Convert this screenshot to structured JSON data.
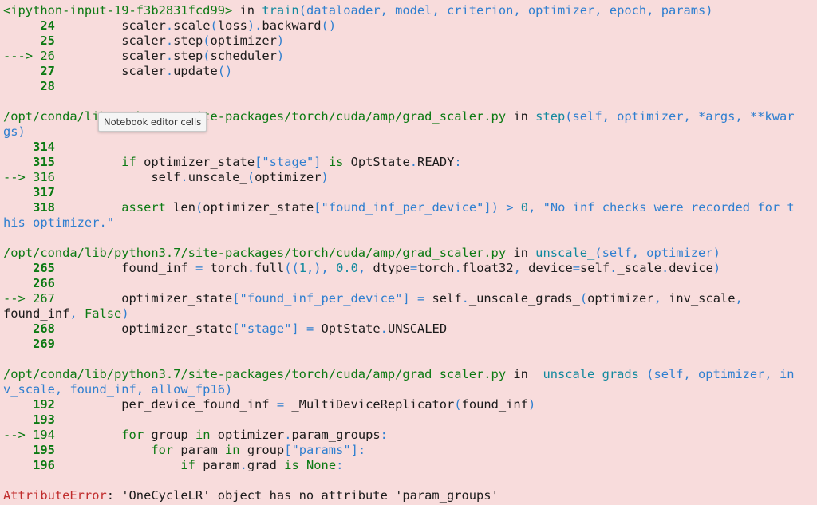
{
  "tooltip": "Notebook editor cells",
  "rows": [
    [
      {
        "t": "<ipython-input-19-f3b2831fcd99>",
        "c": "g"
      },
      {
        "t": " in ",
        "c": ""
      },
      {
        "t": "train",
        "c": "c"
      },
      {
        "t": "(dataloader, model, criterion, optimizer, epoch, params)",
        "c": "b"
      }
    ],
    [
      {
        "t": "     24",
        "c": "gb"
      },
      {
        "t": "         scaler",
        "c": ""
      },
      {
        "t": ".",
        "c": "b"
      },
      {
        "t": "scale",
        "c": ""
      },
      {
        "t": "(",
        "c": "b"
      },
      {
        "t": "loss",
        "c": ""
      },
      {
        "t": ")",
        "c": "b"
      },
      {
        "t": ".",
        "c": "b"
      },
      {
        "t": "backward",
        "c": ""
      },
      {
        "t": "()",
        "c": "b"
      }
    ],
    [
      {
        "t": "     25",
        "c": "gb"
      },
      {
        "t": "         scaler",
        "c": ""
      },
      {
        "t": ".",
        "c": "b"
      },
      {
        "t": "step",
        "c": ""
      },
      {
        "t": "(",
        "c": "b"
      },
      {
        "t": "optimizer",
        "c": ""
      },
      {
        "t": ")",
        "c": "b"
      }
    ],
    [
      {
        "t": "---> 26",
        "c": "g"
      },
      {
        "t": "         scaler",
        "c": ""
      },
      {
        "t": ".",
        "c": "b"
      },
      {
        "t": "step",
        "c": ""
      },
      {
        "t": "(",
        "c": "b"
      },
      {
        "t": "scheduler",
        "c": ""
      },
      {
        "t": ")",
        "c": "b"
      }
    ],
    [
      {
        "t": "     27",
        "c": "gb"
      },
      {
        "t": "         scaler",
        "c": ""
      },
      {
        "t": ".",
        "c": "b"
      },
      {
        "t": "update",
        "c": ""
      },
      {
        "t": "()",
        "c": "b"
      }
    ],
    [
      {
        "t": "     28",
        "c": "gb"
      }
    ],
    [],
    [
      {
        "t": "/opt/conda/lib/python3.7/site-packages/torch/cuda/amp/grad_scaler.py",
        "c": "g"
      },
      {
        "t": " in ",
        "c": ""
      },
      {
        "t": "step",
        "c": "c"
      },
      {
        "t": "(self, optimizer, *args, **kwar",
        "c": "b"
      }
    ],
    [
      {
        "t": "gs)",
        "c": "b"
      }
    ],
    [
      {
        "t": "    314",
        "c": "gb"
      }
    ],
    [
      {
        "t": "    315",
        "c": "gb"
      },
      {
        "t": "         ",
        "c": ""
      },
      {
        "t": "if",
        "c": "g"
      },
      {
        "t": " optimizer_state",
        "c": ""
      },
      {
        "t": "[",
        "c": "b"
      },
      {
        "t": "\"stage\"",
        "c": "b"
      },
      {
        "t": "]",
        "c": "b"
      },
      {
        "t": " ",
        "c": ""
      },
      {
        "t": "is",
        "c": "g"
      },
      {
        "t": " OptState",
        "c": ""
      },
      {
        "t": ".",
        "c": "b"
      },
      {
        "t": "READY",
        "c": ""
      },
      {
        "t": ":",
        "c": "b"
      }
    ],
    [
      {
        "t": "--> 316",
        "c": "g"
      },
      {
        "t": "             self",
        "c": ""
      },
      {
        "t": ".",
        "c": "b"
      },
      {
        "t": "unscale_",
        "c": ""
      },
      {
        "t": "(",
        "c": "b"
      },
      {
        "t": "optimizer",
        "c": ""
      },
      {
        "t": ")",
        "c": "b"
      }
    ],
    [
      {
        "t": "    317",
        "c": "gb"
      }
    ],
    [
      {
        "t": "    318",
        "c": "gb"
      },
      {
        "t": "         ",
        "c": ""
      },
      {
        "t": "assert",
        "c": "g"
      },
      {
        "t": " len",
        "c": ""
      },
      {
        "t": "(",
        "c": "b"
      },
      {
        "t": "optimizer_state",
        "c": ""
      },
      {
        "t": "[",
        "c": "b"
      },
      {
        "t": "\"found_inf_per_device\"",
        "c": "b"
      },
      {
        "t": "])",
        "c": "b"
      },
      {
        "t": " ",
        "c": ""
      },
      {
        "t": ">",
        "c": "b"
      },
      {
        "t": " ",
        "c": ""
      },
      {
        "t": "0",
        "c": "c"
      },
      {
        "t": ",",
        "c": "b"
      },
      {
        "t": " \"No inf checks were recorded for t",
        "c": "b"
      }
    ],
    [
      {
        "t": "his optimizer.\"",
        "c": "b"
      }
    ],
    [],
    [
      {
        "t": "/opt/conda/lib/python3.7/site-packages/torch/cuda/amp/grad_scaler.py",
        "c": "g"
      },
      {
        "t": " in ",
        "c": ""
      },
      {
        "t": "unscale_",
        "c": "c"
      },
      {
        "t": "(self, optimizer)",
        "c": "b"
      }
    ],
    [
      {
        "t": "    265",
        "c": "gb"
      },
      {
        "t": "         found_inf ",
        "c": ""
      },
      {
        "t": "=",
        "c": "b"
      },
      {
        "t": " torch",
        "c": ""
      },
      {
        "t": ".",
        "c": "b"
      },
      {
        "t": "full",
        "c": ""
      },
      {
        "t": "((",
        "c": "b"
      },
      {
        "t": "1",
        "c": "c"
      },
      {
        "t": ",),",
        "c": "b"
      },
      {
        "t": " ",
        "c": ""
      },
      {
        "t": "0.0",
        "c": "c"
      },
      {
        "t": ",",
        "c": "b"
      },
      {
        "t": " dtype",
        "c": ""
      },
      {
        "t": "=",
        "c": "b"
      },
      {
        "t": "torch",
        "c": ""
      },
      {
        "t": ".",
        "c": "b"
      },
      {
        "t": "float32",
        "c": ""
      },
      {
        "t": ",",
        "c": "b"
      },
      {
        "t": " device",
        "c": ""
      },
      {
        "t": "=",
        "c": "b"
      },
      {
        "t": "self",
        "c": ""
      },
      {
        "t": ".",
        "c": "b"
      },
      {
        "t": "_scale",
        "c": ""
      },
      {
        "t": ".",
        "c": "b"
      },
      {
        "t": "device",
        "c": ""
      },
      {
        "t": ")",
        "c": "b"
      }
    ],
    [
      {
        "t": "    266",
        "c": "gb"
      }
    ],
    [
      {
        "t": "--> 267",
        "c": "g"
      },
      {
        "t": "         optimizer_state",
        "c": ""
      },
      {
        "t": "[",
        "c": "b"
      },
      {
        "t": "\"found_inf_per_device\"",
        "c": "b"
      },
      {
        "t": "]",
        "c": "b"
      },
      {
        "t": " ",
        "c": ""
      },
      {
        "t": "=",
        "c": "b"
      },
      {
        "t": " self",
        "c": ""
      },
      {
        "t": ".",
        "c": "b"
      },
      {
        "t": "_unscale_grads_",
        "c": ""
      },
      {
        "t": "(",
        "c": "b"
      },
      {
        "t": "optimizer",
        "c": ""
      },
      {
        "t": ",",
        "c": "b"
      },
      {
        "t": " inv_scale",
        "c": ""
      },
      {
        "t": ",",
        "c": "b"
      }
    ],
    [
      {
        "t": "found_inf",
        "c": ""
      },
      {
        "t": ",",
        "c": "b"
      },
      {
        "t": " ",
        "c": ""
      },
      {
        "t": "False",
        "c": "g"
      },
      {
        "t": ")",
        "c": "b"
      }
    ],
    [
      {
        "t": "    268",
        "c": "gb"
      },
      {
        "t": "         optimizer_state",
        "c": ""
      },
      {
        "t": "[",
        "c": "b"
      },
      {
        "t": "\"stage\"",
        "c": "b"
      },
      {
        "t": "]",
        "c": "b"
      },
      {
        "t": " ",
        "c": ""
      },
      {
        "t": "=",
        "c": "b"
      },
      {
        "t": " OptState",
        "c": ""
      },
      {
        "t": ".",
        "c": "b"
      },
      {
        "t": "UNSCALED",
        "c": ""
      }
    ],
    [
      {
        "t": "    269",
        "c": "gb"
      }
    ],
    [],
    [
      {
        "t": "/opt/conda/lib/python3.7/site-packages/torch/cuda/amp/grad_scaler.py",
        "c": "g"
      },
      {
        "t": " in ",
        "c": ""
      },
      {
        "t": "_unscale_grads_",
        "c": "c"
      },
      {
        "t": "(self, optimizer, in",
        "c": "b"
      }
    ],
    [
      {
        "t": "v_scale, found_inf, allow_fp16)",
        "c": "b"
      }
    ],
    [
      {
        "t": "    192",
        "c": "gb"
      },
      {
        "t": "         per_device_found_inf ",
        "c": ""
      },
      {
        "t": "=",
        "c": "b"
      },
      {
        "t": " _MultiDeviceReplicator",
        "c": ""
      },
      {
        "t": "(",
        "c": "b"
      },
      {
        "t": "found_inf",
        "c": ""
      },
      {
        "t": ")",
        "c": "b"
      }
    ],
    [
      {
        "t": "    193",
        "c": "gb"
      }
    ],
    [
      {
        "t": "--> 194",
        "c": "g"
      },
      {
        "t": "         ",
        "c": ""
      },
      {
        "t": "for",
        "c": "g"
      },
      {
        "t": " group ",
        "c": ""
      },
      {
        "t": "in",
        "c": "g"
      },
      {
        "t": " optimizer",
        "c": ""
      },
      {
        "t": ".",
        "c": "b"
      },
      {
        "t": "param_groups",
        "c": ""
      },
      {
        "t": ":",
        "c": "b"
      }
    ],
    [
      {
        "t": "    195",
        "c": "gb"
      },
      {
        "t": "             ",
        "c": ""
      },
      {
        "t": "for",
        "c": "g"
      },
      {
        "t": " param ",
        "c": ""
      },
      {
        "t": "in",
        "c": "g"
      },
      {
        "t": " group",
        "c": ""
      },
      {
        "t": "[",
        "c": "b"
      },
      {
        "t": "\"params\"",
        "c": "b"
      },
      {
        "t": "]:",
        "c": "b"
      }
    ],
    [
      {
        "t": "    196",
        "c": "gb"
      },
      {
        "t": "                 ",
        "c": ""
      },
      {
        "t": "if",
        "c": "g"
      },
      {
        "t": " param",
        "c": ""
      },
      {
        "t": ".",
        "c": "b"
      },
      {
        "t": "grad ",
        "c": ""
      },
      {
        "t": "is",
        "c": "g"
      },
      {
        "t": " ",
        "c": ""
      },
      {
        "t": "None",
        "c": "g"
      },
      {
        "t": ":",
        "c": "b"
      }
    ],
    [],
    [
      {
        "t": "AttributeError",
        "c": "r"
      },
      {
        "t": ": 'OneCycleLR' object has no attribute 'param_groups'",
        "c": ""
      }
    ]
  ]
}
